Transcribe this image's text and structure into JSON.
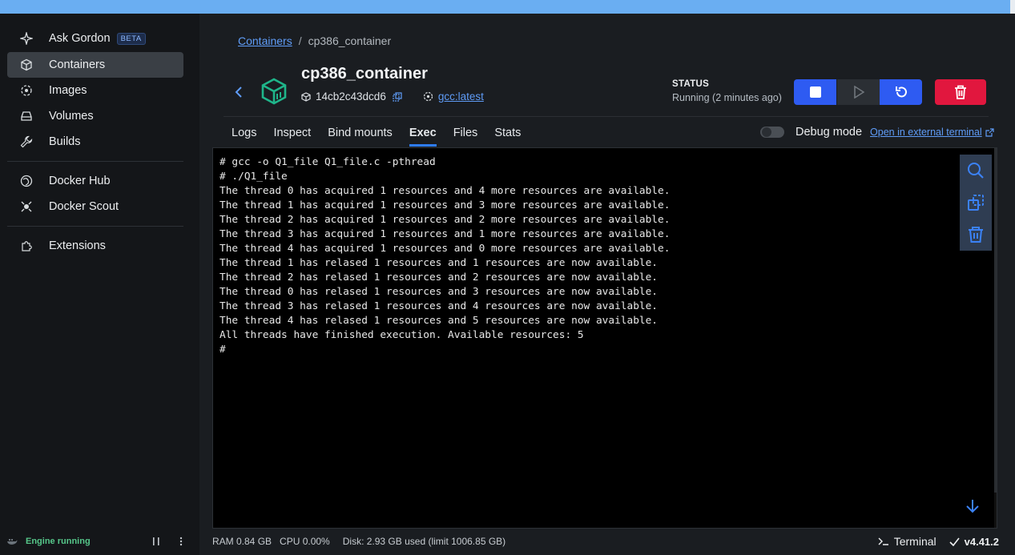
{
  "sidebar": {
    "items": [
      {
        "label": "Ask Gordon",
        "badge": "BETA",
        "icon": "sparkle-icon"
      },
      {
        "label": "Containers",
        "icon": "container-icon",
        "active": true
      },
      {
        "label": "Images",
        "icon": "images-icon"
      },
      {
        "label": "Volumes",
        "icon": "volumes-icon"
      },
      {
        "label": "Builds",
        "icon": "wrench-icon"
      }
    ],
    "hub_items": [
      {
        "label": "Docker Hub",
        "icon": "hub-icon"
      },
      {
        "label": "Docker Scout",
        "icon": "scout-icon"
      }
    ],
    "ext_items": [
      {
        "label": "Extensions",
        "icon": "puzzle-icon"
      }
    ],
    "footer": {
      "engine": "Engine running"
    }
  },
  "breadcrumb": {
    "parent": "Containers",
    "separator": "/",
    "current": "cp386_container"
  },
  "container": {
    "name": "cp386_container",
    "id": "14cb2c43dcd6",
    "image": "gcc:latest"
  },
  "status": {
    "title": "STATUS",
    "value": "Running (2 minutes ago)"
  },
  "tabs": [
    {
      "label": "Logs"
    },
    {
      "label": "Inspect"
    },
    {
      "label": "Bind mounts"
    },
    {
      "label": "Exec",
      "active": true
    },
    {
      "label": "Files"
    },
    {
      "label": "Stats"
    }
  ],
  "debug": {
    "label": "Debug mode",
    "enabled": false,
    "external_link": "Open in external terminal"
  },
  "terminal": {
    "lines": [
      "# gcc -o Q1_file Q1_file.c -pthread",
      "# ./Q1_file",
      "The thread 0 has acquired 1 resources and 4 more resources are available.",
      "The thread 1 has acquired 1 resources and 3 more resources are available.",
      "The thread 2 has acquired 1 resources and 2 more resources are available.",
      "The thread 3 has acquired 1 resources and 1 more resources are available.",
      "The thread 4 has acquired 1 resources and 0 more resources are available.",
      "The thread 1 has relased 1 resources and 1 resources are now available.",
      "The thread 2 has relased 1 resources and 2 resources are now available.",
      "The thread 0 has relased 1 resources and 3 resources are now available.",
      "The thread 3 has relased 1 resources and 4 resources are now available.",
      "The thread 4 has relased 1 resources and 5 resources are now available.",
      "All threads have finished execution. Available resources: 5",
      "#"
    ]
  },
  "statusbar": {
    "ram": "RAM 0.84 GB",
    "cpu": "CPU 0.00%",
    "disk": "Disk: 2.93 GB used (limit 1006.85 GB)",
    "terminal": "Terminal",
    "version": "v4.41.2"
  },
  "colors": {
    "accent": "#2e5bf2",
    "danger": "#e1173e",
    "link": "#5f9cf7",
    "engine_ok": "#56c78a",
    "container_icon": "#1fb58a"
  }
}
